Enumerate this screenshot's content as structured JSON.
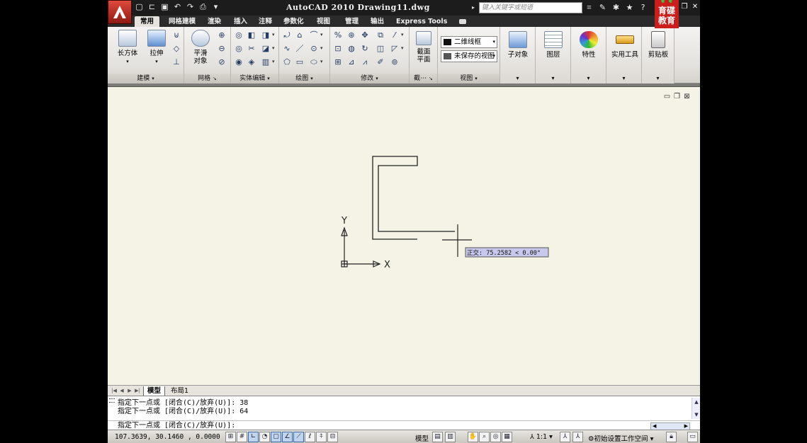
{
  "title_bar": {
    "title": "AutoCAD 2010  Drawing11.dwg",
    "search_placeholder": "键入关键字或短语",
    "logo_text_line1": "育碟",
    "logo_text_line2": "教育"
  },
  "tabs": [
    "常用",
    "网格建模",
    "渲染",
    "插入",
    "注释",
    "参数化",
    "视图",
    "管理",
    "输出",
    "Express Tools"
  ],
  "ribbon": {
    "modeling": {
      "title": "建模",
      "box_label": "长方体",
      "extrude_label": "拉伸"
    },
    "mesh": {
      "title": "网格",
      "smooth_label_1": "平滑",
      "smooth_label_2": "对象"
    },
    "solid_edit": {
      "title": "实体编辑"
    },
    "draw": {
      "title": "绘图"
    },
    "modify": {
      "title": "修改"
    },
    "section": {
      "title": "截⋯",
      "label_1": "截面",
      "label_2": "平面"
    },
    "view": {
      "title": "视图",
      "visual_style": "二维线框",
      "saved_view": "未保存的视图"
    },
    "subobject_label": "子对象",
    "layers_label": "图层",
    "properties_label": "特性",
    "utilities_label": "实用工具",
    "clipboard_label": "剪贴板"
  },
  "drawing": {
    "ucs_x": "X",
    "ucs_y": "Y",
    "tooltip": "正交: 75.2582 < 0.00°"
  },
  "layout_tabs": [
    "模型",
    "布局1"
  ],
  "command_line": {
    "history_1": "指定下一点或 [闭合(C)/放弃(U)]: 38",
    "history_2": "指定下一点或 [闭合(C)/放弃(U)]: 64",
    "prompt": "指定下一点或 [闭合(C)/放弃(U)]:"
  },
  "status_bar": {
    "coordinates": "107.3639, 30.1460 , 0.0000",
    "model_label": "模型",
    "scale_label": "1:1",
    "workspace_label": "初始设置工作空间"
  },
  "colors": {
    "title_bg": "#1c1c1c",
    "drawing_bg": "#f5f3e5",
    "logo_red": "#cc1d1d",
    "tooltip_bg": "#c8c8ec"
  },
  "icons": {
    "app_menu": "autocad-a-icon",
    "qat": [
      "new-icon",
      "open-icon",
      "save-icon",
      "undo-icon",
      "redo-icon",
      "print-icon",
      "dropdown-icon"
    ],
    "title_tools": [
      "binoculars-icon",
      "key-icon",
      "network-icon",
      "star-icon",
      "help-icon"
    ]
  }
}
